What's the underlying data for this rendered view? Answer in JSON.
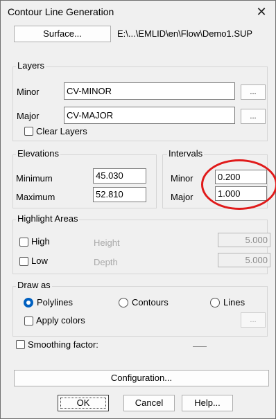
{
  "window": {
    "title": "Contour Line Generation",
    "close_glyph": "✕"
  },
  "surface": {
    "button_label": "Surface...",
    "path": "E:\\...\\EMLID\\en\\Flow\\Demo1.SUP"
  },
  "layers": {
    "group_label": "Layers",
    "minor_label": "Minor",
    "minor_value": "CV-MINOR",
    "major_label": "Major",
    "major_value": "CV-MAJOR",
    "browse_label": "...",
    "clear_label": "Clear Layers"
  },
  "elevations": {
    "group_label": "Elevations",
    "minimum_label": "Minimum",
    "minimum_value": "45.030",
    "maximum_label": "Maximum",
    "maximum_value": "52.810"
  },
  "intervals": {
    "group_label": "Intervals",
    "minor_label": "Minor",
    "minor_value": "0.200",
    "major_label": "Major",
    "major_value": "1.000"
  },
  "highlight": {
    "group_label": "Highlight Areas",
    "high_label": "High",
    "height_label": "Height",
    "height_value": "5.000",
    "low_label": "Low",
    "depth_label": "Depth",
    "depth_value": "5.000"
  },
  "draw_as": {
    "group_label": "Draw as",
    "options": [
      "Polylines",
      "Contours",
      "Lines"
    ],
    "selected": "Polylines",
    "apply_colors_label": "Apply colors",
    "colors_browse_label": "..."
  },
  "smoothing": {
    "label": "Smoothing factor:"
  },
  "buttons": {
    "configuration": "Configuration...",
    "ok": "OK",
    "cancel": "Cancel",
    "help": "Help..."
  },
  "annotation": {
    "color": "#e01a1a",
    "shape": "ellipse-circling-intervals"
  }
}
